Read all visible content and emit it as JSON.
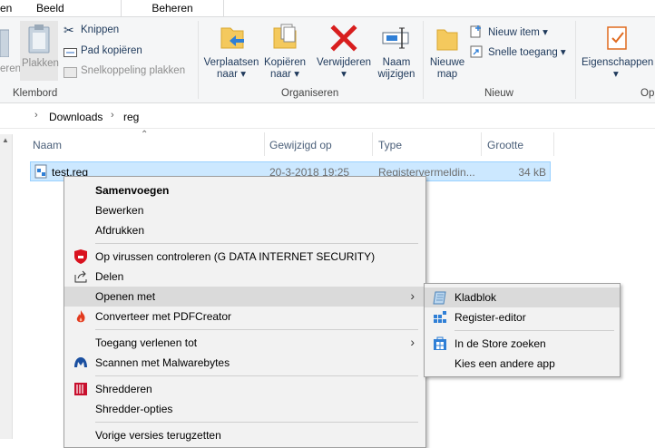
{
  "ribbon_tabs": {
    "left_cut": "en",
    "view": "Beeld",
    "manage": "Beheren"
  },
  "clipboard": {
    "paste_cut": "eren",
    "paste": "Plakken",
    "cut": "Knippen",
    "copy_path": "Pad kopiëren",
    "paste_shortcut": "Snelkoppeling plakken",
    "group_label": "Klembord"
  },
  "organize": {
    "move_to_line1": "Verplaatsen",
    "move_to_line2": "naar ▾",
    "copy_to_line1": "Kopiëren",
    "copy_to_line2": "naar ▾",
    "delete_line1": "Verwijderen",
    "delete_line2": "▾",
    "rename_line1": "Naam",
    "rename_line2": "wijzigen",
    "group_label": "Organiseren"
  },
  "new": {
    "new_folder_line1": "Nieuwe",
    "new_folder_line2": "map",
    "new_item": "Nieuw item ▾",
    "easy_access": "Snelle toegang ▾",
    "group_label": "Nieuw"
  },
  "open": {
    "properties": "Eigenschappen",
    "properties_arrow": "▾",
    "group_label_cut": "Op"
  },
  "address": {
    "crumb1": "Downloads",
    "crumb2": "reg"
  },
  "columns": {
    "name": "Naam",
    "modified": "Gewijzigd op",
    "type": "Type",
    "size": "Grootte"
  },
  "file": {
    "name": "test.reg",
    "modified": "20-3-2018 19:25",
    "type": "Registervermeldin...",
    "size": "34 kB"
  },
  "context_menu": {
    "merge": "Samenvoegen",
    "edit": "Bewerken",
    "print": "Afdrukken",
    "scan": "Op virussen controleren (G DATA INTERNET SECURITY)",
    "share": "Delen",
    "open_with": "Openen met",
    "pdf": "Converteer met PDFCreator",
    "grant_access": "Toegang verlenen tot",
    "malwarebytes": "Scannen met Malwarebytes",
    "shred": "Shredderen",
    "shred_options": "Shredder-opties",
    "prev_versions": "Vorige versies terugzetten"
  },
  "open_with_menu": {
    "notepad": "Kladblok",
    "regedit": "Register-editor",
    "store": "In de Store zoeken",
    "other": "Kies een andere app"
  },
  "colors": {
    "selection": "#cce8ff",
    "menu_bg": "#f2f2f2",
    "highlight": "#dadada"
  }
}
